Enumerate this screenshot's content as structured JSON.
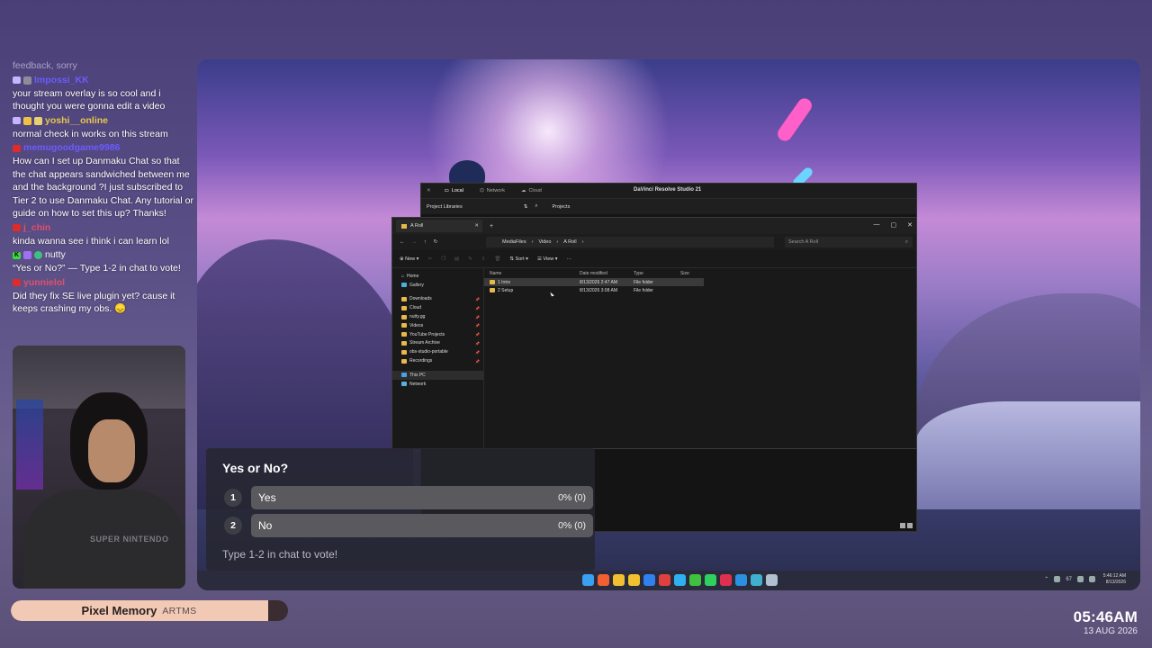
{
  "chat": {
    "faded_top": "feedback, sorry",
    "messages": [
      {
        "platform": "tw",
        "user": "Impossi_KK",
        "user_color": "#6a5cff",
        "text": "your stream overlay is so cool and i thought you were gonna edit a video"
      },
      {
        "platform": "tw",
        "user": "yoshi__online",
        "user_color": "#e8c84a",
        "text": "normal check in works on this stream"
      },
      {
        "platform": "yt",
        "user": "memugoodgame9986",
        "user_color": "#6a5cff",
        "text": "How can I set up Danmaku Chat so that the chat appears sandwiched between me and the background ?I just subscribed to Tier 2 to use Danmaku Chat. Any tutorial or guide on how to set this up? Thanks!"
      },
      {
        "platform": "yt",
        "user": "j_chin",
        "user_color": "#e0506a",
        "text": "kinda wanna see i think i can learn lol"
      },
      {
        "platform": "kk",
        "user": "nutty",
        "user_color": "#f0f0f0",
        "text": "“Yes or No?” — Type 1-2 in chat to vote!"
      },
      {
        "platform": "yt",
        "user": "yunnielol",
        "user_color": "#e0506a",
        "text": "Did they fix SE live plugin yet? cause it keeps crashing my obs. 😞"
      }
    ]
  },
  "webcam": {
    "shirt_text": "SUPER NINTENDO"
  },
  "now_playing": {
    "song": "Pixel Memory",
    "artist": "ARTMS",
    "progress": 0.93,
    "accent": "#f2c9b5"
  },
  "clock": {
    "time": "05:46AM",
    "date": "13 AUG 2026"
  },
  "resolve": {
    "tabs": [
      {
        "label": "Local",
        "active": true
      },
      {
        "label": "Network",
        "active": false
      },
      {
        "label": "Cloud",
        "active": false
      }
    ],
    "title": "DaVinci Resolve Studio 21",
    "project_libraries": "Project Libraries",
    "projects": "Projects"
  },
  "explorer": {
    "tab_title": "A Roll",
    "breadcrumbs": [
      "MediaFiles",
      "Video",
      "A Roll"
    ],
    "search_placeholder": "Search A Roll",
    "commands": {
      "new": "New",
      "sort": "Sort",
      "view": "View",
      "more": "···"
    },
    "nav": {
      "top": [
        "Home",
        "Gallery"
      ],
      "pinned": [
        "Downloads",
        "Cloud",
        "nutty.gg",
        "Videos",
        "YouTube Projects",
        "Stream Archive",
        "obs-studio-portable",
        "Recordings"
      ],
      "bottom": [
        "This PC",
        "Network"
      ]
    },
    "columns": [
      "Name",
      "Date modified",
      "Type",
      "Size"
    ],
    "rows": [
      {
        "name": "1 Intro",
        "date": "8/13/2026 2:47 AM",
        "type": "File folder",
        "size": ""
      },
      {
        "name": "2 Setup",
        "date": "8/13/2026 3:08 AM",
        "type": "File folder",
        "size": ""
      }
    ]
  },
  "poll": {
    "title": "Yes or No?",
    "options": [
      {
        "num": "1",
        "label": "Yes",
        "pct": "0% (0)"
      },
      {
        "num": "2",
        "label": "No",
        "pct": "0% (0)"
      }
    ],
    "footer": "Type 1-2 in chat to vote!"
  },
  "taskbar": {
    "app_colors": [
      "#3aa0f0",
      "#f06030",
      "#f0c030",
      "#f0c030",
      "#3080f0",
      "#e04040",
      "#30b0f0",
      "#40c040",
      "#30d060",
      "#e03050",
      "#2a90e0",
      "#40b0d0",
      "#b0c0d0"
    ],
    "tray_text": "67",
    "time": "5:46:12 AM",
    "date": "8/13/2026"
  }
}
